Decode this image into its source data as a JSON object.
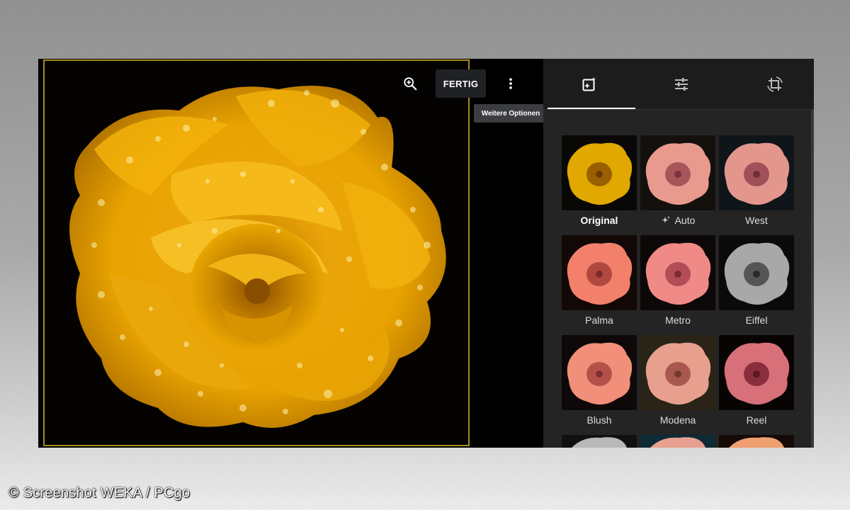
{
  "toolbar": {
    "zoom_icon": "zoom-in-icon",
    "done_label": "FERTIG",
    "more_icon": "more-vert-icon",
    "more_tooltip": "Weitere Optionen"
  },
  "tabs": [
    {
      "icon": "auto-fix-icon",
      "active": true
    },
    {
      "icon": "sliders-icon",
      "active": false
    },
    {
      "icon": "crop-rotate-icon",
      "active": false
    }
  ],
  "filters": [
    {
      "label": "Original",
      "selected": true,
      "tint": "#e0a800"
    },
    {
      "label": "Auto",
      "selected": false,
      "tint": "#e89a8e",
      "icon": "sparkle-icon"
    },
    {
      "label": "West",
      "selected": false,
      "tint": "#e3978c"
    },
    {
      "label": "Palma",
      "selected": false,
      "tint": "#f2806a"
    },
    {
      "label": "Metro",
      "selected": false,
      "tint": "#f08a86"
    },
    {
      "label": "Eiffel",
      "selected": false,
      "tint": "#a8a8a8"
    },
    {
      "label": "Blush",
      "selected": false,
      "tint": "#f28f7a"
    },
    {
      "label": "Modena",
      "selected": false,
      "tint": "#e8a08e"
    },
    {
      "label": "Reel",
      "selected": false,
      "tint": "#d8707a"
    }
  ],
  "caption": "© Screenshot WEKA / PCgo",
  "colors": {
    "accent": "#ffffff",
    "frame": "#a58b1c",
    "rose": "#e3a400"
  }
}
